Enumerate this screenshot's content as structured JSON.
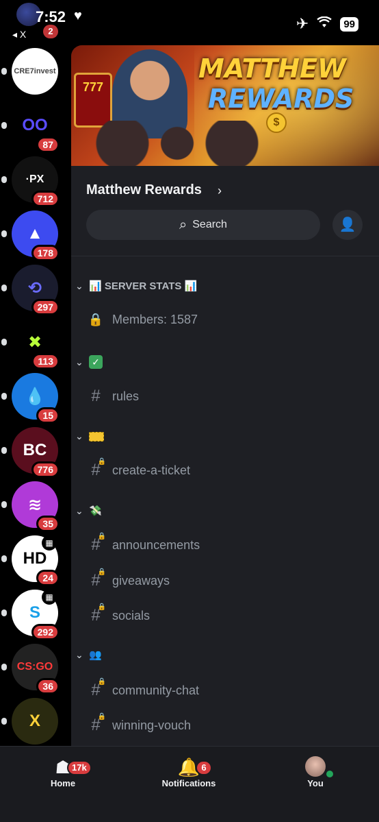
{
  "status_bar": {
    "time": "7:52",
    "back_label": "◂ X",
    "notif_count": "2",
    "battery": "99"
  },
  "rail": {
    "servers": [
      {
        "name": "CRE7invest",
        "icon_text": "CRE7invest",
        "badge": "",
        "bg": "#ffffff",
        "fg": "#444444"
      },
      {
        "name": "server-2",
        "icon_text": "OO",
        "badge": "87",
        "bg": "#000000",
        "fg": "#5a4cff"
      },
      {
        "name": "PX",
        "icon_text": "·PX",
        "badge": "712",
        "bg": "#111111",
        "fg": "#ffffff"
      },
      {
        "name": "server-4",
        "icon_text": "▲",
        "badge": "178",
        "bg": "#3d4bf0",
        "fg": "#ffffff"
      },
      {
        "name": "server-5",
        "icon_text": "⟲",
        "badge": "297",
        "bg": "#1a1c2e",
        "fg": "#6a6cff"
      },
      {
        "name": "server-6",
        "icon_text": "✖",
        "badge": "113",
        "bg": "#000000",
        "fg": "#b8ff3a"
      },
      {
        "name": "server-7",
        "icon_text": "💧",
        "badge": "15",
        "bg": "#1a7ae0",
        "fg": "#ffffff"
      },
      {
        "name": "BC",
        "icon_text": "BC",
        "badge": "776",
        "bg": "#5a0e1e",
        "fg": "#ffffff"
      },
      {
        "name": "server-9",
        "icon_text": "≋",
        "badge": "35",
        "bg": "#b03ad8",
        "fg": "#ffffff"
      },
      {
        "name": "HD",
        "icon_text": "HD",
        "badge": "24",
        "bg": "#ffffff",
        "fg": "#000000",
        "calendar": true
      },
      {
        "name": "server-11",
        "icon_text": "S",
        "badge": "292",
        "bg": "#ffffff",
        "fg": "#1aa0e8",
        "calendar": true
      },
      {
        "name": "CS:GO Roll",
        "icon_text": "CS:GO",
        "badge": "36",
        "bg": "#222222",
        "fg": "#ff3a3a"
      },
      {
        "name": "server-13",
        "icon_text": "X",
        "badge": "",
        "bg": "#2a2a10",
        "fg": "#ffd23a"
      }
    ]
  },
  "banner": {
    "title_line1": "MATTHEW",
    "title_line2": "REWARDS",
    "slot_text": "777",
    "coin_symbol": "$"
  },
  "server": {
    "name": "Matthew Rewards",
    "search_placeholder": "Search"
  },
  "channels": {
    "cat_stats": "📊 SERVER STATS 📊",
    "members": "Members: 1587",
    "rules": "rules",
    "create_ticket": "create-a-ticket",
    "announcements": "announcements",
    "giveaways": "giveaways",
    "socials": "socials",
    "community_chat": "community-chat",
    "winning_vouch": "winning-vouch",
    "cat_money_emoji": "💸",
    "cat_people_emoji": "👥"
  },
  "bottom_nav": {
    "home_label": "Home",
    "home_badge": "17k",
    "notifications_label": "Notifications",
    "notifications_badge": "6",
    "you_label": "You"
  }
}
